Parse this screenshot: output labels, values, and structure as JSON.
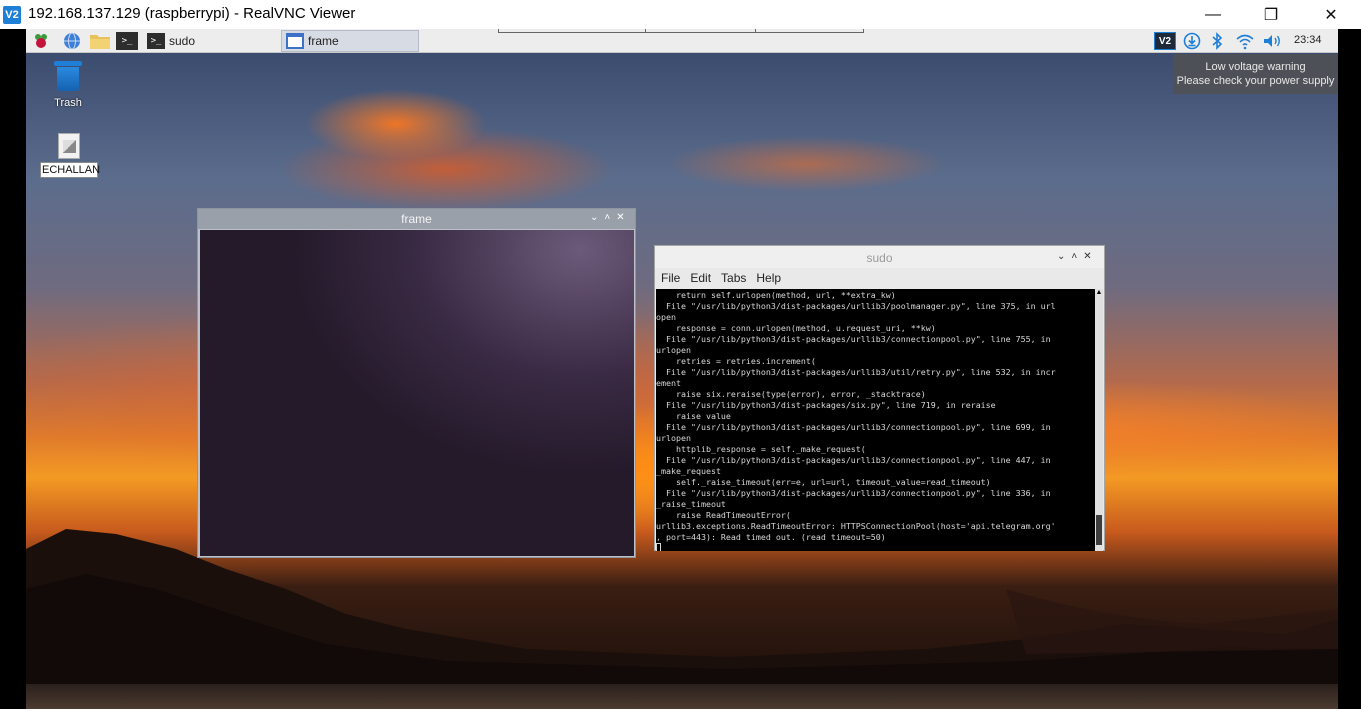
{
  "viewer": {
    "title": "192.168.137.129 (raspberrypi) - RealVNC Viewer",
    "logo_text": "V2",
    "minimize": "—",
    "maximize": "❐",
    "close": "✕"
  },
  "taskbar": {
    "menu_icon": "raspberry-icon",
    "browser_icon": "globe-icon",
    "files_icon": "folder-icon",
    "terminal_icon": "terminal-icon",
    "terminal_glyph": ">_",
    "tasks": [
      {
        "label": "sudo",
        "icon": "terminal-icon"
      },
      {
        "label": "frame",
        "icon": "window-icon"
      }
    ],
    "tray": {
      "vnc_text": "V2",
      "update_icon": "download-icon",
      "bluetooth_icon": "bluetooth-icon",
      "wifi_icon": "wifi-icon",
      "volume_icon": "volume-icon",
      "clock": "23:34"
    }
  },
  "notification": {
    "line1": "Low voltage warning",
    "line2": "Please check your power supply"
  },
  "desktop_icons": [
    {
      "label": "Trash",
      "icon": "trash-icon"
    },
    {
      "label": "ECHALLAN",
      "icon": "document-icon"
    }
  ],
  "frame_window": {
    "title": "frame",
    "buttons": [
      "⌄",
      "˄",
      "✕"
    ]
  },
  "sudo_window": {
    "title": "sudo",
    "buttons": [
      "⌄",
      "˄",
      "✕"
    ],
    "menu": [
      "File",
      "Edit",
      "Tabs",
      "Help"
    ],
    "terminal_lines": [
      "    return self.urlopen(method, url, **extra_kw)",
      "  File \"/usr/lib/python3/dist-packages/urllib3/poolmanager.py\", line 375, in url",
      "open",
      "    response = conn.urlopen(method, u.request_uri, **kw)",
      "  File \"/usr/lib/python3/dist-packages/urllib3/connectionpool.py\", line 755, in",
      "urlopen",
      "    retries = retries.increment(",
      "  File \"/usr/lib/python3/dist-packages/urllib3/util/retry.py\", line 532, in incr",
      "ement",
      "    raise six.reraise(type(error), error, _stacktrace)",
      "  File \"/usr/lib/python3/dist-packages/six.py\", line 719, in reraise",
      "    raise value",
      "  File \"/usr/lib/python3/dist-packages/urllib3/connectionpool.py\", line 699, in",
      "urlopen",
      "    httplib_response = self._make_request(",
      "  File \"/usr/lib/python3/dist-packages/urllib3/connectionpool.py\", line 447, in",
      "_make_request",
      "    self._raise_timeout(err=e, url=url, timeout_value=read_timeout)",
      "  File \"/usr/lib/python3/dist-packages/urllib3/connectionpool.py\", line 336, in",
      "_raise_timeout",
      "    raise ReadTimeoutError(",
      "urllib3.exceptions.ReadTimeoutError: HTTPSConnectionPool(host='api.telegram.org'",
      ", port=443): Read timed out. (read timeout=50)"
    ]
  }
}
